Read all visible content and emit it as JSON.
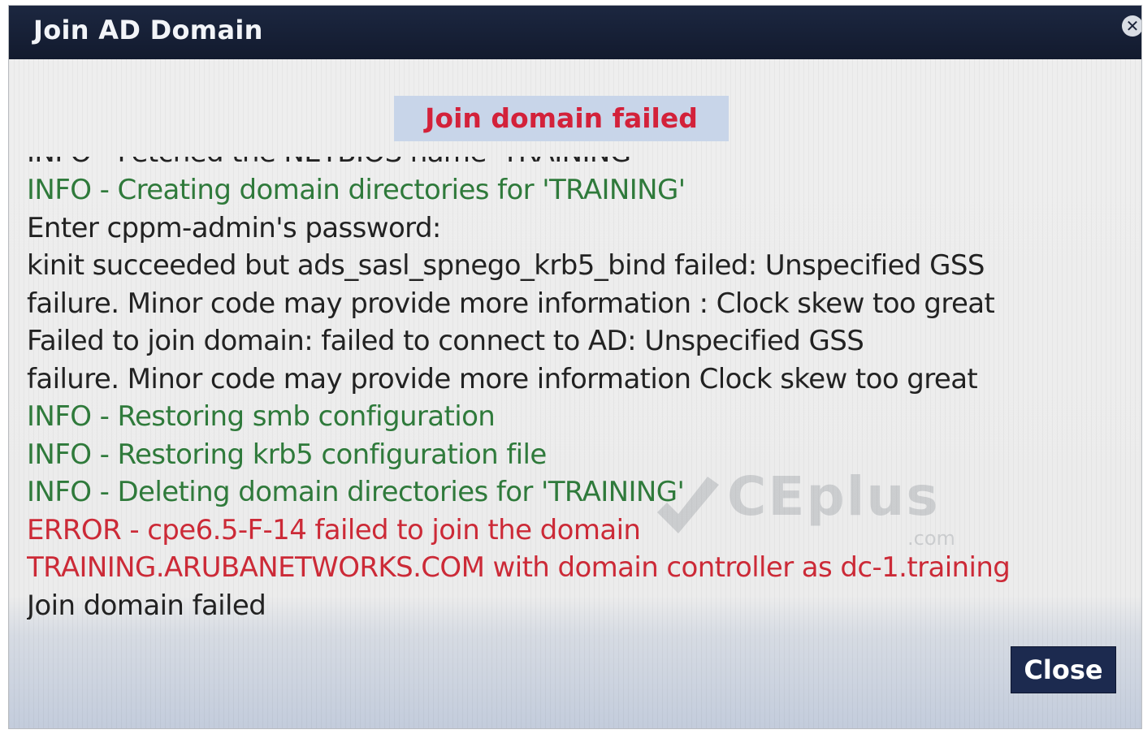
{
  "dialog": {
    "title": "Join AD Domain",
    "close_icon_glyph": "✕",
    "status_banner": "Join domain failed",
    "close_button_label": "Close"
  },
  "log": {
    "clipped_line": "INFO - Fetched the NETBIOS name 'TRAINING'",
    "lines": [
      {
        "text": "INFO - Creating domain directories for 'TRAINING'",
        "kind": "info"
      },
      {
        "text": "Enter cppm-admin's password:",
        "kind": "plain"
      },
      {
        "text": "kinit succeeded but ads_sasl_spnego_krb5_bind failed: Unspecified GSS",
        "kind": "plain"
      },
      {
        "text": "failure. Minor code may provide more information : Clock skew too great",
        "kind": "plain"
      },
      {
        "text": "Failed to join domain: failed to connect to AD: Unspecified GSS",
        "kind": "plain"
      },
      {
        "text": "failure. Minor code may provide more information   Clock skew too great",
        "kind": "plain"
      },
      {
        "text": "INFO - Restoring smb configuration",
        "kind": "info"
      },
      {
        "text": "INFO - Restoring krb5 configuration file",
        "kind": "info"
      },
      {
        "text": "INFO - Deleting domain directories for 'TRAINING'",
        "kind": "info"
      },
      {
        "text": "ERROR - cpe6.5-F-14 failed to join the domain",
        "kind": "error"
      },
      {
        "text": "TRAINING.ARUBANETWORKS.COM with domain controller as dc-1.training",
        "kind": "error"
      },
      {
        "text": "Join domain failed",
        "kind": "plain"
      }
    ]
  },
  "watermark": {
    "brand": "CEplus",
    "suffix": ".com"
  },
  "colors": {
    "titlebar": "#121a2e",
    "info_text": "#2f7a3b",
    "error_text": "#cc2a37",
    "plain_text": "#222222",
    "banner_bg": "#c8d5e9",
    "banner_text": "#d3213a",
    "button_bg": "#1c2a4f"
  },
  "icons": {
    "close": "close-icon"
  }
}
